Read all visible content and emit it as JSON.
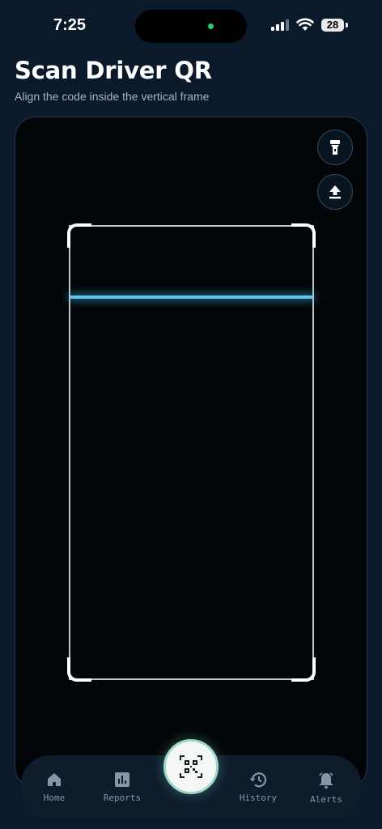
{
  "status_bar": {
    "time": "7:25",
    "battery": "28"
  },
  "header": {
    "title": "Scan Driver QR",
    "subtitle": "Align the code inside the vertical frame"
  },
  "camera": {
    "flashlight_icon": "flashlight-icon",
    "upload_icon": "upload-icon",
    "scan_line_color": "#5bc8f0"
  },
  "nav": {
    "items": [
      {
        "label": "Home",
        "icon": "home-icon"
      },
      {
        "label": "Reports",
        "icon": "reports-icon"
      },
      {
        "label": "History",
        "icon": "history-icon"
      },
      {
        "label": "Alerts",
        "icon": "bell-icon"
      }
    ],
    "scan_button_icon": "qr-code-icon"
  }
}
